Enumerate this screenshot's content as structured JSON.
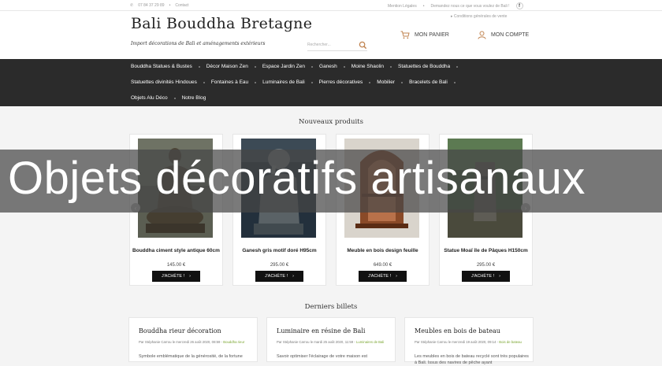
{
  "topbar": {
    "phone": "07 84 37 29 89",
    "contact": "Contact",
    "legal": "Mention Légales",
    "ask": "Demandez nous ce que vous voulez de Bali !",
    "fb": "f",
    "cgv": "Conditions générales de vente"
  },
  "header": {
    "logo": "Bali Bouddha Bretagne",
    "tagline": "Import décorations de Bali et aménagements extérieurs",
    "search_placeholder": "Rechercher...",
    "cart_label": "MON PANIER",
    "account_label": "MON COMPTE"
  },
  "nav": {
    "row1": [
      "Bouddha Statues & Bustes",
      "Décor Maison Zen",
      "Espace Jardin Zen",
      "Ganesh",
      "Moine Shaolin",
      "Statuettes de Bouddha"
    ],
    "row2": [
      "Statuettes divinités Hindoues",
      "Fontaines à Eau",
      "Luminaires de Bali",
      "Pierres décoratives",
      "Mobilier",
      "Bracelets de Bali"
    ],
    "row3": [
      "Objets Alu Déco",
      "Notre Blog"
    ]
  },
  "products": {
    "title": "Nouveaux produits",
    "items": [
      {
        "name": "Bouddha ciment style antique 60cm",
        "price": "145.00 €",
        "button": "J'ACHÈTE !"
      },
      {
        "name": "Ganesh gris motif doré H95cm",
        "price": "295.00 €",
        "button": "J'ACHÈTE !"
      },
      {
        "name": "Meuble en bois design feuille",
        "price": "649.00 €",
        "button": "J'ACHÈTE !"
      },
      {
        "name": "Statue Moaï île de Pâques H150cm",
        "price": "295.00 €",
        "button": "J'ACHÈTE !"
      }
    ]
  },
  "banner": {
    "text": "Objets décoratifs artisanaux"
  },
  "blog": {
    "title": "Derniers billets",
    "posts": [
      {
        "title": "Bouddha rieur décoration",
        "meta": "Par Stéphanie Carrou le mercredi 26 août 2020, 08:59 -",
        "category": "Bouddha rieur",
        "excerpt": "Symbole emblématique de la générosité, de la fortune"
      },
      {
        "title": "Luminaire en résine de Bali",
        "meta": "Par Stéphanie Carrou le mardi 25 août 2020, 11:59 -",
        "category": "Luminaires de Bali",
        "excerpt": "Savoir optimiser l'éclairage de votre maison est"
      },
      {
        "title": "Meubles en bois de bateau",
        "meta": "Par Stéphanie Carrou le mercredi 19 août 2020, 09:14 -",
        "category": "Bois de bateau",
        "excerpt": "Les meubles en bois de bateau recyclé sont très populaires à Bali. Issus des navires de pêche ayant"
      }
    ]
  }
}
